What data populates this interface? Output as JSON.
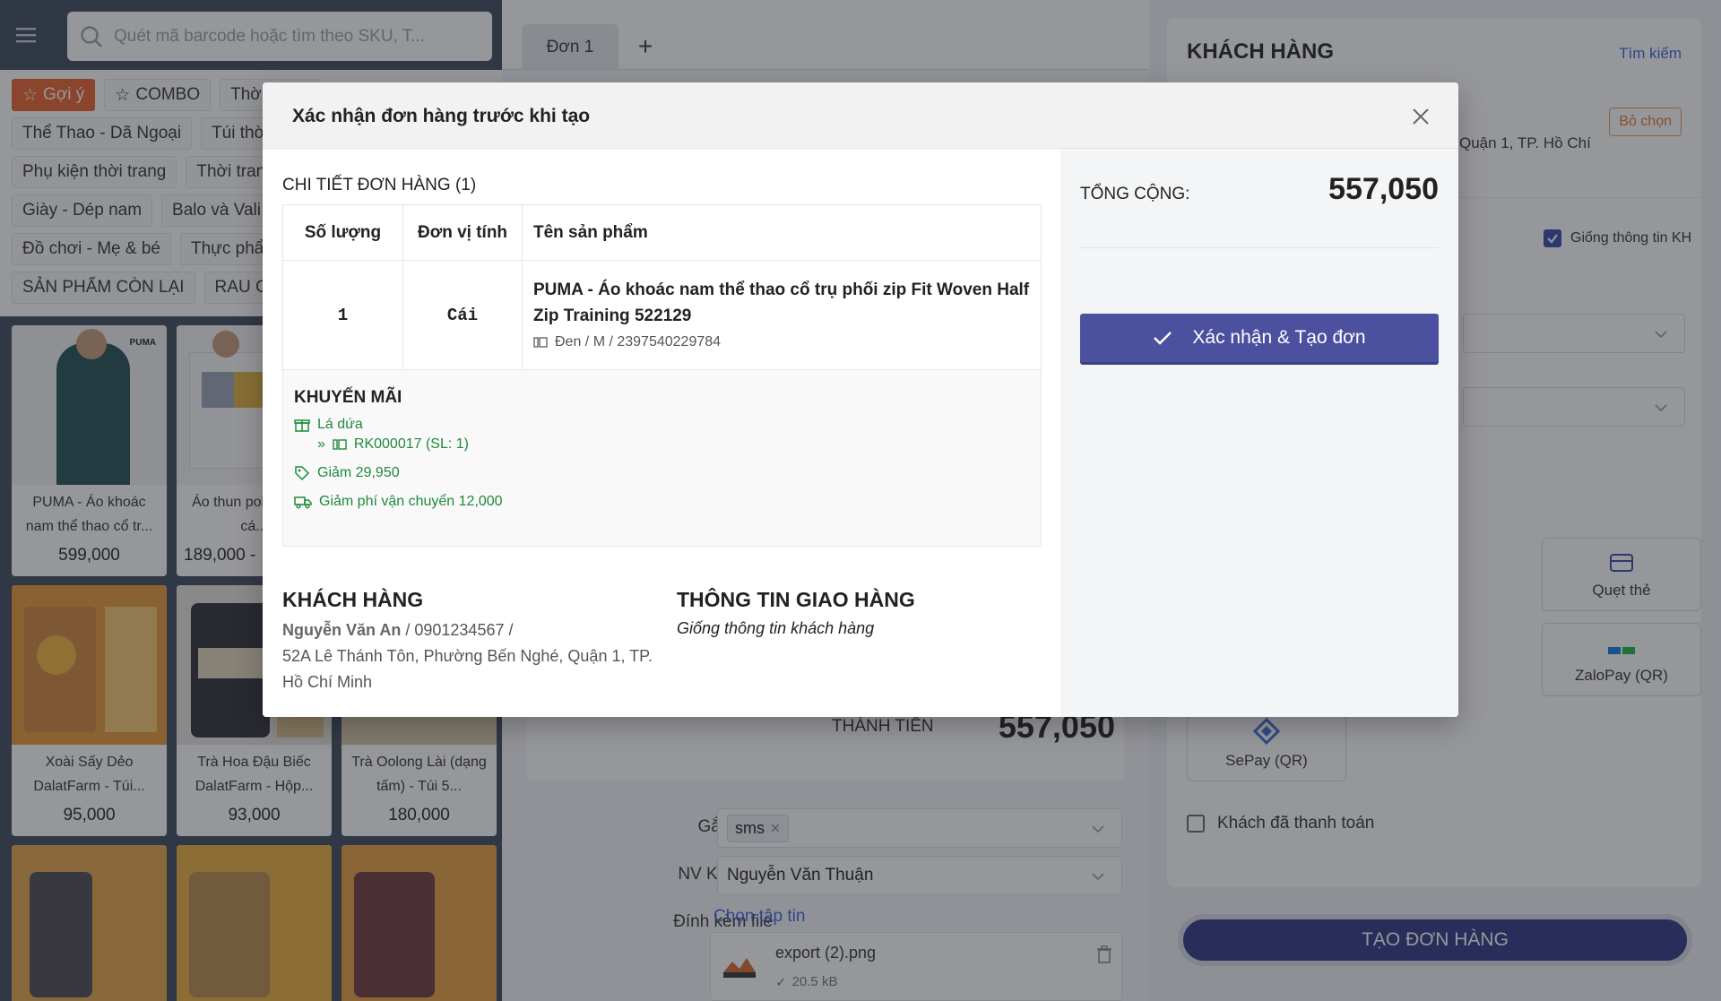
{
  "search": {
    "placeholder": "Quét mã barcode hoặc tìm theo SKU, T..."
  },
  "categories": {
    "row1": [
      "Gợi ý",
      "COMBO",
      "Thời trang"
    ],
    "row2": [
      "Thể Thao - Dã Ngoại",
      "Túi thời trang"
    ],
    "row3": [
      "Phụ kiện thời trang",
      "Thời trang"
    ],
    "row4": [
      "Giày - Dép nam",
      "Balo và Vali"
    ],
    "row5": [
      "Đồ chơi - Mẹ & bé",
      "Thực phẩm"
    ],
    "row6": [
      "SẢN PHẨM CÒN LẠI",
      "RAU CỦ"
    ]
  },
  "products": [
    {
      "name": "PUMA - Áo khoác nam thể thao cổ tr...",
      "price": "599,000"
    },
    {
      "name": "Áo thun polo phong cá...",
      "price": "189,000 -"
    },
    {
      "name": "Xoài Sấy Dẻo DalatFarm - Túi...",
      "price": "95,000"
    },
    {
      "name": "Trà Hoa Đậu Biếc DalatFarm - Hộp...",
      "price": "93,000"
    },
    {
      "name": "Trà Oolong Lài (dạng tấm) - Túi 5...",
      "price": "180,000"
    }
  ],
  "order_tab": {
    "label": "Đơn 1",
    "add": "+"
  },
  "order": {
    "total_label": "THÀNH TIỀN",
    "total_value": "557,050",
    "tag_label": "Gắn nhãn",
    "tag_value": "sms",
    "sales_label": "NV K.Doanh",
    "sales_value": "Nguyễn Văn Thuận",
    "attach_label": "Đính kèm file",
    "attach_link": "Chọn tập tin",
    "file_name": "export (2).png",
    "file_size": "20.5 kB"
  },
  "right_panel": {
    "title": "KHÁCH HÀNG",
    "search_link": "Tìm kiếm",
    "deselect": "Bỏ chọn",
    "address_fragment": "Quận 1, TP. Hồ Chí",
    "same_info": "Giống thông tin KH",
    "pay_card": "Quẹt thẻ",
    "pay_zalo": "ZaloPay (QR)",
    "pay_sepay": "SePay (QR)",
    "pay_frag1": "t",
    "pay_frag2": "R)",
    "paid": "Khách đã thanh toán",
    "create_btn": "TẠO ĐƠN HÀNG"
  },
  "modal": {
    "title": "Xác nhận đơn hàng trước khi tạo",
    "detail_title": "CHI TIẾT ĐƠN HÀNG (1)",
    "headers": {
      "qty": "Số lượng",
      "unit": "Đơn vị tính",
      "name": "Tên sản phẩm"
    },
    "item": {
      "qty": "1",
      "unit": "Cái",
      "name": "PUMA - Áo khoác nam thể thao cổ trụ phối zip Fit Woven Half Zip Training 522129",
      "variant": "Đen / M / 2397540229784"
    },
    "promo": {
      "title": "KHUYẾN MÃI",
      "gift": "Lá dứa",
      "gift_item": "» ",
      "gift_code": "RK000017 (SL: 1)",
      "discount": "Giảm 29,950",
      "shipping": "Giảm phí vận chuyển 12,000"
    },
    "customer": {
      "title": "KHÁCH HÀNG",
      "name": "Nguyễn Văn An",
      "phone": " / 0901234567 /",
      "address": "52A Lê Thánh Tôn, Phường Bến Nghé, Quận 1, TP. Hồ Chí Minh"
    },
    "shipping": {
      "title": "THÔNG TIN GIAO HÀNG",
      "value": "Giống thông tin khách hàng"
    },
    "total_label": "TỔNG CỘNG:",
    "total_value": "557,050",
    "confirm": "Xác nhận & Tạo đơn"
  },
  "colors": {
    "accent": "#4b519f",
    "brand_dark": "#2d3580",
    "chip_active": "#e9632b",
    "promo_green": "#1f8a3a",
    "link": "#3d63dd"
  }
}
